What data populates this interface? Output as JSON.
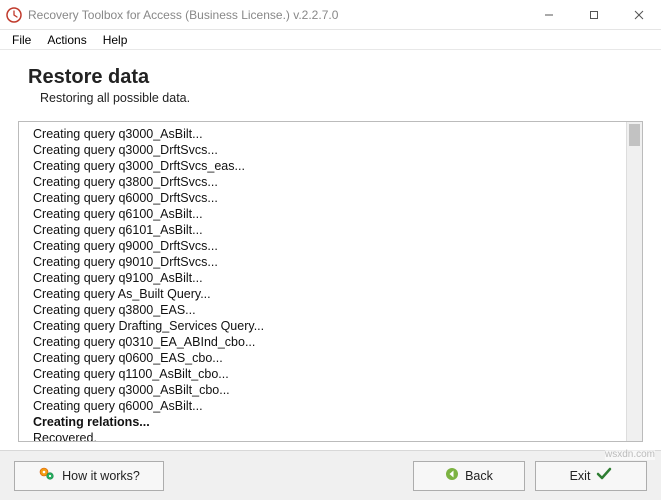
{
  "window": {
    "title": "Recovery Toolbox for Access (Business License.) v.2.2.7.0"
  },
  "menu": {
    "file": "File",
    "actions": "Actions",
    "help": "Help"
  },
  "header": {
    "title": "Restore data",
    "subtitle": "Restoring all possible data."
  },
  "log": {
    "lines": [
      {
        "text": "Creating query q3000_AsBilt..."
      },
      {
        "text": "Creating query q3000_DrftSvcs..."
      },
      {
        "text": "Creating query q3000_DrftSvcs_eas..."
      },
      {
        "text": "Creating query q3800_DrftSvcs..."
      },
      {
        "text": "Creating query q6000_DrftSvcs..."
      },
      {
        "text": "Creating query q6100_AsBilt..."
      },
      {
        "text": "Creating query q6101_AsBilt..."
      },
      {
        "text": "Creating query q9000_DrftSvcs..."
      },
      {
        "text": "Creating query q9010_DrftSvcs..."
      },
      {
        "text": "Creating query q9100_AsBilt..."
      },
      {
        "text": "Creating query As_Built Query..."
      },
      {
        "text": "Creating query q3800_EAS..."
      },
      {
        "text": "Creating query Drafting_Services Query..."
      },
      {
        "text": "Creating query q0310_EA_ABInd_cbo..."
      },
      {
        "text": "Creating query q0600_EAS_cbo..."
      },
      {
        "text": "Creating query q1100_AsBilt_cbo..."
      },
      {
        "text": "Creating query q3000_AsBilt_cbo..."
      },
      {
        "text": "Creating query q6000_AsBilt..."
      },
      {
        "text": "Creating relations...",
        "bold": true
      },
      {
        "text": "Recovered."
      }
    ]
  },
  "footer": {
    "how": "How it works?",
    "back": "Back",
    "exit": "Exit"
  },
  "watermark": "wsxdn.com"
}
